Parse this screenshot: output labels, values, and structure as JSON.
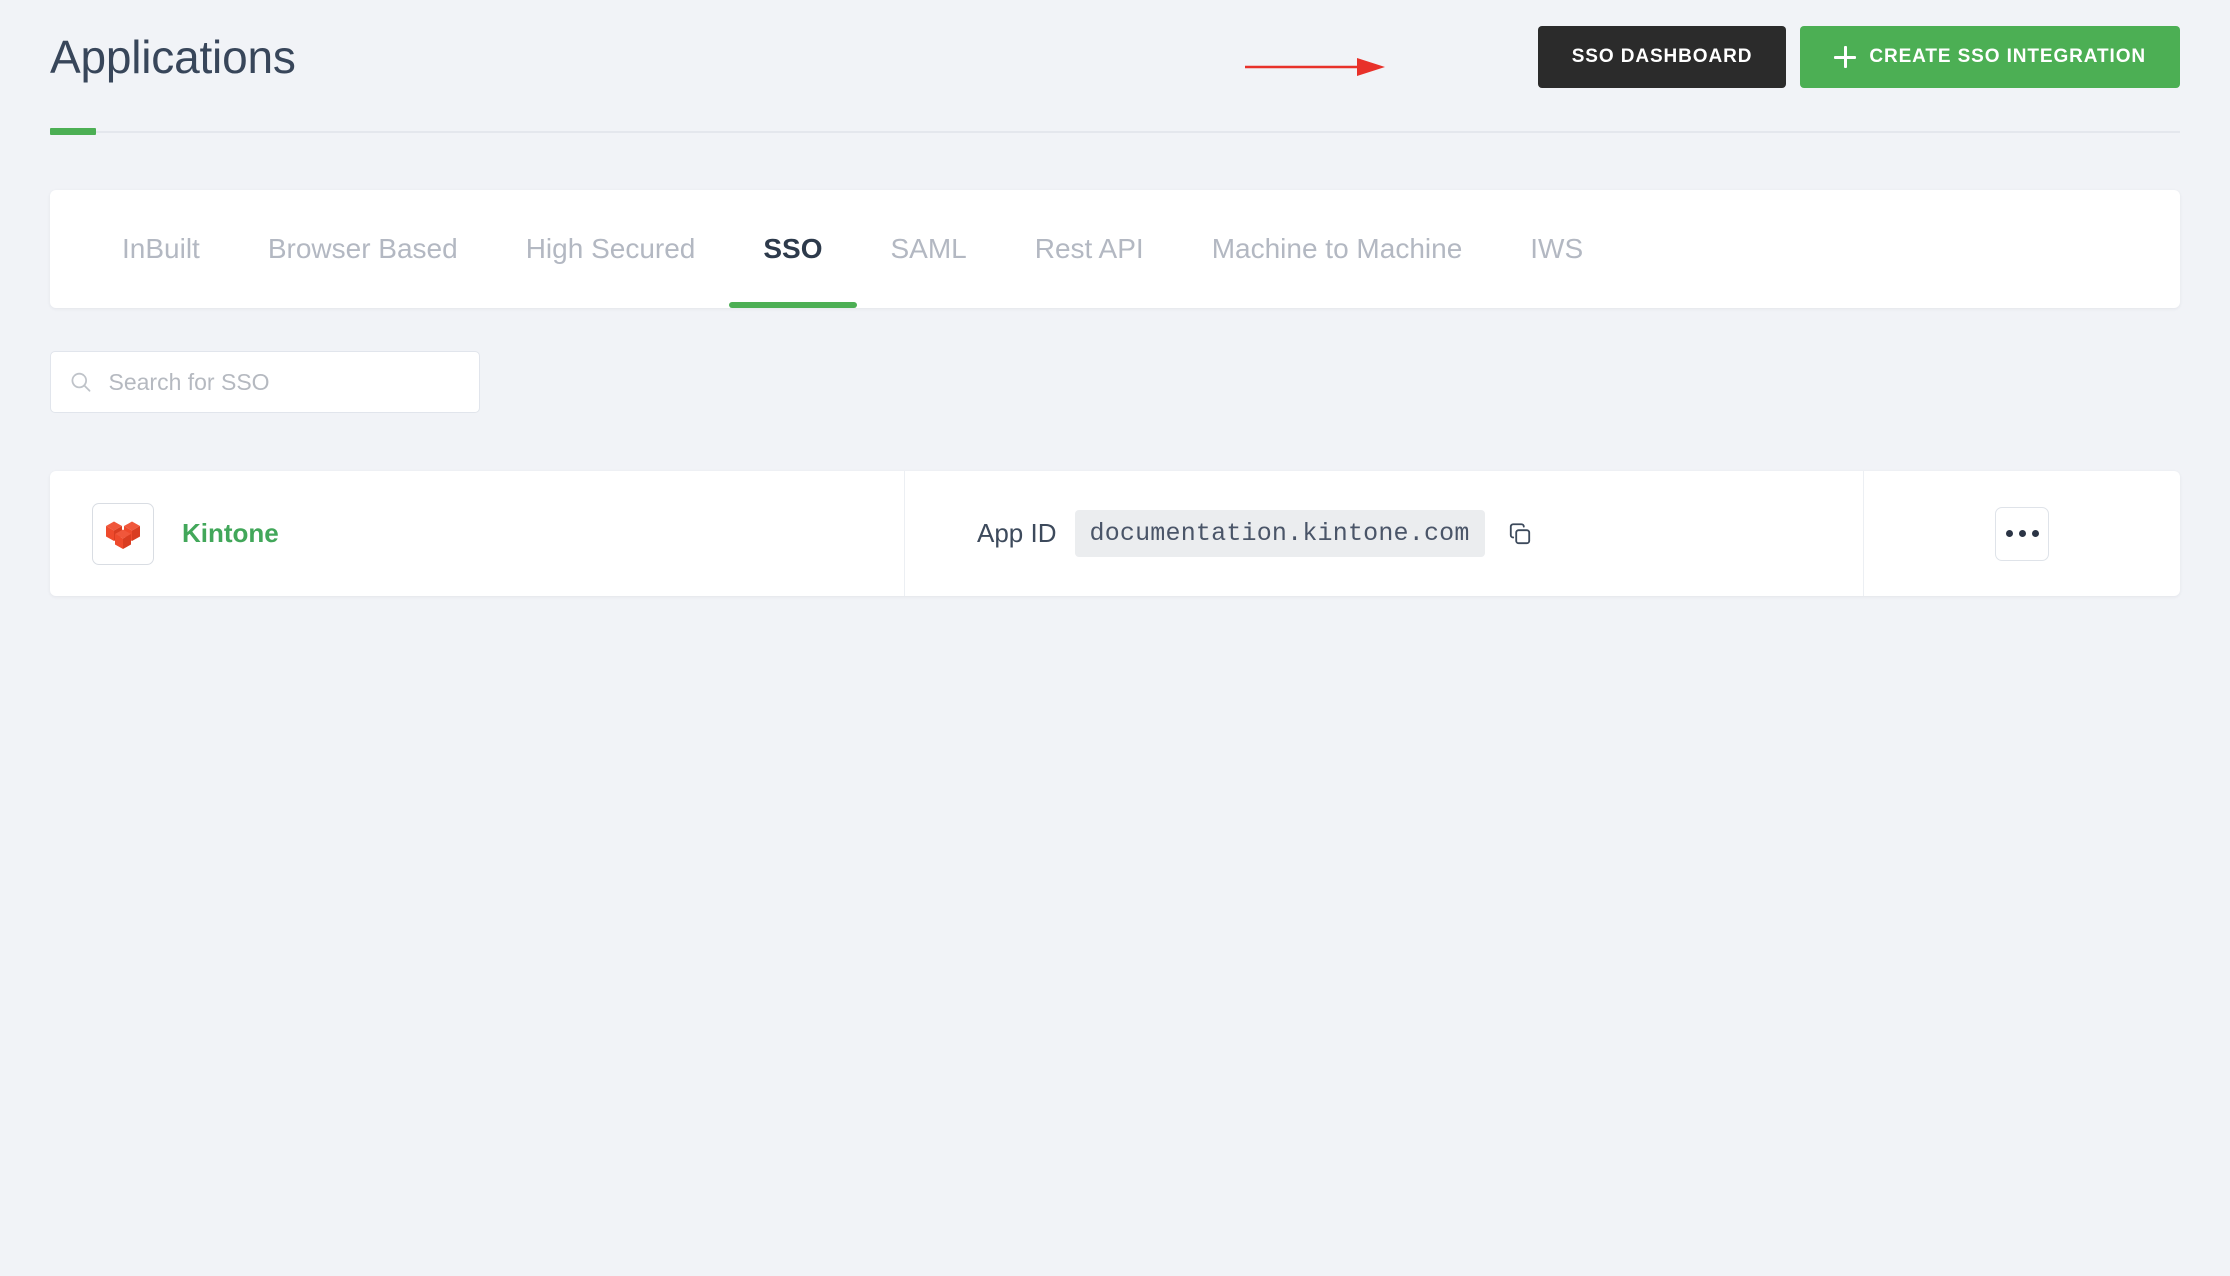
{
  "header": {
    "title": "Applications",
    "accent_color": "#4caf54",
    "buttons": {
      "dashboard_label": "SSO DASHBOARD",
      "create_label": "CREATE SSO INTEGRATION",
      "create_icon": "plus-icon",
      "dark_color": "#2b2b2b",
      "green_color": "#4caf54"
    },
    "annotation": {
      "type": "arrow",
      "color": "#e8312a",
      "points_to": "SSO DASHBOARD"
    }
  },
  "tabs": [
    {
      "label": "InBuilt",
      "active": false
    },
    {
      "label": "Browser Based",
      "active": false
    },
    {
      "label": "High Secured",
      "active": false
    },
    {
      "label": "SSO",
      "active": true
    },
    {
      "label": "SAML",
      "active": false
    },
    {
      "label": "Rest API",
      "active": false
    },
    {
      "label": "Machine to Machine",
      "active": false
    },
    {
      "label": "IWS",
      "active": false
    }
  ],
  "search": {
    "placeholder": "Search for SSO",
    "value": "",
    "icon": "search-icon"
  },
  "applications": [
    {
      "name": "Kintone",
      "name_color": "#42a75a",
      "logo_icon": "kintone-cube-logo-icon",
      "logo_color": "#ee4a2c",
      "app_id_label": "App ID",
      "app_id_value": "documentation.kintone.com",
      "copy_icon": "copy-icon",
      "menu_icon": "ellipsis-icon"
    }
  ]
}
